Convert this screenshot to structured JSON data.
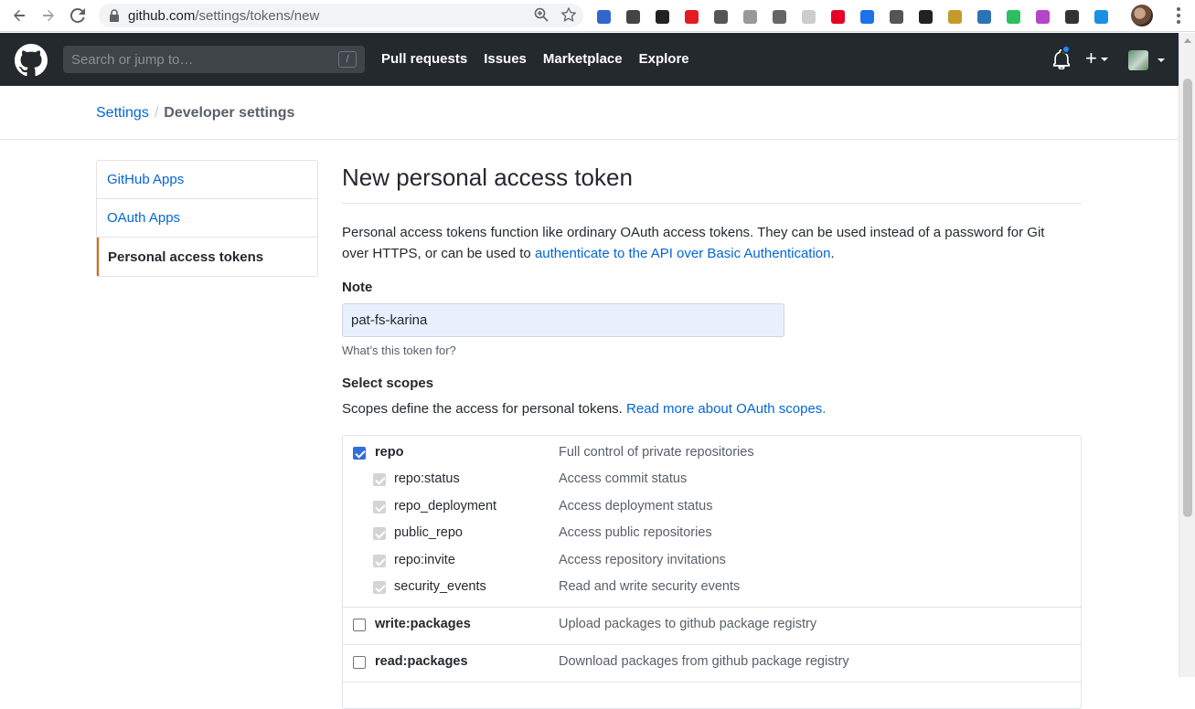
{
  "browser": {
    "url_host": "github.com",
    "url_path": "/settings/tokens/new",
    "extension_icons": [
      {
        "name": "lastpass-icon",
        "color": "#3366cc"
      },
      {
        "name": "privacy-badger-icon",
        "color": "#444444"
      },
      {
        "name": "window-icon",
        "color": "#222222"
      },
      {
        "name": "acrobat-icon",
        "color": "#e31b23"
      },
      {
        "name": "sync-icon",
        "color": "#555555"
      },
      {
        "name": "cast-icon",
        "color": "#999999"
      },
      {
        "name": "pocket-icon",
        "color": "#666666"
      },
      {
        "name": "blank-icon",
        "color": "#cccccc"
      },
      {
        "name": "pinterest-icon",
        "color": "#e60023"
      },
      {
        "name": "clock-icon",
        "color": "#1a73e8"
      },
      {
        "name": "pin-icon",
        "color": "#555555"
      },
      {
        "name": "pushpin-icon",
        "color": "#222222"
      },
      {
        "name": "scanner-icon",
        "color": "#c49a2a"
      },
      {
        "name": "magnifier-icon",
        "color": "#2b73b7"
      },
      {
        "name": "evernote-icon",
        "color": "#2dbe60"
      },
      {
        "name": "bag-icon",
        "color": "#b544c9"
      },
      {
        "name": "screenshot-icon",
        "color": "#333333"
      },
      {
        "name": "cube-icon",
        "color": "#1a8fe3"
      }
    ]
  },
  "header": {
    "search_placeholder": "Search or jump to…",
    "search_shortcut": "/",
    "nav": [
      "Pull requests",
      "Issues",
      "Marketplace",
      "Explore"
    ],
    "plus_label": "+"
  },
  "breadcrumb": {
    "parent": "Settings",
    "separator": "/",
    "current": "Developer settings"
  },
  "sidebar": {
    "items": [
      {
        "label": "GitHub Apps",
        "active": false
      },
      {
        "label": "OAuth Apps",
        "active": false
      },
      {
        "label": "Personal access tokens",
        "active": true
      }
    ]
  },
  "main": {
    "title": "New personal access token",
    "intro_text": "Personal access tokens function like ordinary OAuth access tokens. They can be used instead of a password for Git over HTTPS, or can be used to ",
    "intro_link": "authenticate to the API over Basic Authentication",
    "intro_end": ".",
    "note_label": "Note",
    "note_value": "pat-fs-karina",
    "note_hint": "What’s this token for?",
    "scopes_label": "Select scopes",
    "scopes_desc": "Scopes define the access for personal tokens. ",
    "scopes_link": "Read more about OAuth scopes."
  },
  "scopes": [
    {
      "name": "repo",
      "desc": "Full control of private repositories",
      "checked": true,
      "children": [
        {
          "name": "repo:status",
          "desc": "Access commit status"
        },
        {
          "name": "repo_deployment",
          "desc": "Access deployment status"
        },
        {
          "name": "public_repo",
          "desc": "Access public repositories"
        },
        {
          "name": "repo:invite",
          "desc": "Access repository invitations"
        },
        {
          "name": "security_events",
          "desc": "Read and write security events"
        }
      ]
    },
    {
      "name": "write:packages",
      "desc": "Upload packages to github package registry",
      "checked": false,
      "children": []
    },
    {
      "name": "read:packages",
      "desc": "Download packages from github package registry",
      "checked": false,
      "children": []
    }
  ]
}
